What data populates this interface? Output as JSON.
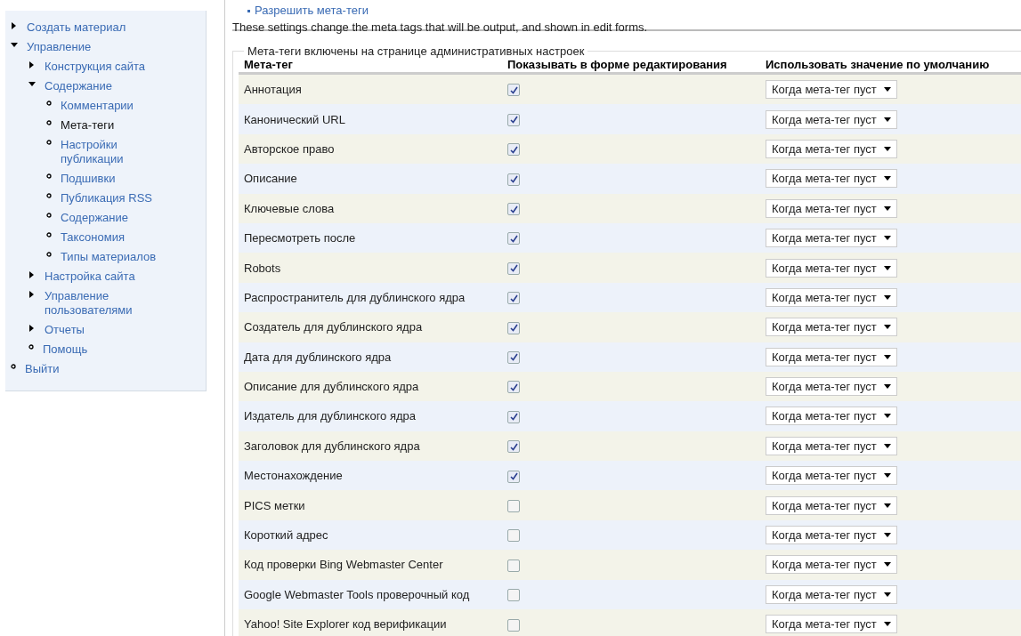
{
  "sidebar": {
    "items": [
      {
        "label": "Создать материал",
        "kind": "branch",
        "expanded": false,
        "selected": false
      },
      {
        "label": "Управление",
        "kind": "branch",
        "expanded": true,
        "selected": false,
        "children": [
          {
            "label": "Конструкция сайта",
            "kind": "branch",
            "expanded": false,
            "selected": false
          },
          {
            "label": "Содержание",
            "kind": "branch",
            "expanded": true,
            "selected": false,
            "children": [
              {
                "label": "Комментарии",
                "kind": "leaf",
                "selected": false
              },
              {
                "label": "Мета-теги",
                "kind": "leaf",
                "selected": true
              },
              {
                "label": "Настройки публикации",
                "kind": "leaf",
                "selected": false
              },
              {
                "label": "Подшивки",
                "kind": "leaf",
                "selected": false
              },
              {
                "label": "Публикация RSS",
                "kind": "leaf",
                "selected": false
              },
              {
                "label": "Содержание",
                "kind": "leaf",
                "selected": false
              },
              {
                "label": "Таксономия",
                "kind": "leaf",
                "selected": false
              },
              {
                "label": "Типы материалов",
                "kind": "leaf",
                "selected": false
              }
            ]
          },
          {
            "label": "Настройка сайта",
            "kind": "branch",
            "expanded": false,
            "selected": false
          },
          {
            "label": "Управление пользователями",
            "kind": "branch",
            "expanded": false,
            "selected": false
          },
          {
            "label": "Отчеты",
            "kind": "branch",
            "expanded": false,
            "selected": false
          },
          {
            "label": "Помощь",
            "kind": "leaf",
            "selected": false
          }
        ]
      },
      {
        "label": "Выйти",
        "kind": "leaf",
        "selected": false
      }
    ]
  },
  "top_link": "Разрешить мета-теги",
  "description": "These settings change the meta tags that will be output, and shown in edit forms.",
  "fieldset": {
    "legend": "Мета-теги включены на странице административных настроек",
    "columns": [
      "Мета-тег",
      "Показывать в форме редактирования",
      "Использовать значение по умолчанию"
    ],
    "rows": [
      {
        "name": "Аннотация",
        "checked": true,
        "default": "Когда мета-тег пуст"
      },
      {
        "name": "Канонический URL",
        "checked": true,
        "default": "Когда мета-тег пуст"
      },
      {
        "name": "Авторское право",
        "checked": true,
        "default": "Когда мета-тег пуст"
      },
      {
        "name": "Описание",
        "checked": true,
        "default": "Когда мета-тег пуст"
      },
      {
        "name": "Ключевые слова",
        "checked": true,
        "default": "Когда мета-тег пуст"
      },
      {
        "name": "Пересмотреть после",
        "checked": true,
        "default": "Когда мета-тег пуст"
      },
      {
        "name": "Robots",
        "checked": true,
        "default": "Когда мета-тег пуст"
      },
      {
        "name": "Распространитель для дублинского ядра",
        "checked": true,
        "default": "Когда мета-тег пуст"
      },
      {
        "name": "Создатель для дублинского ядра",
        "checked": true,
        "default": "Когда мета-тег пуст"
      },
      {
        "name": "Дата для дублинского ядра",
        "checked": true,
        "default": "Когда мета-тег пуст"
      },
      {
        "name": "Описание для дублинского ядра",
        "checked": true,
        "default": "Когда мета-тег пуст"
      },
      {
        "name": "Издатель для дублинского ядра",
        "checked": true,
        "default": "Когда мета-тег пуст"
      },
      {
        "name": "Заголовок для дублинского ядра",
        "checked": true,
        "default": "Когда мета-тег пуст"
      },
      {
        "name": "Местонахождение",
        "checked": true,
        "default": "Когда мета-тег пуст"
      },
      {
        "name": "PICS метки",
        "checked": false,
        "default": "Когда мета-тег пуст"
      },
      {
        "name": "Короткий адрес",
        "checked": false,
        "default": "Когда мета-тег пуст"
      },
      {
        "name": "Код проверки Bing Webmaster Center",
        "checked": false,
        "default": "Когда мета-тег пуст"
      },
      {
        "name": "Google Webmaster Tools проверочный код",
        "checked": false,
        "default": "Когда мета-тег пуст"
      },
      {
        "name": "Yahoo! Site Explorer код верификации",
        "checked": false,
        "default": "Когда мета-тег пуст"
      }
    ]
  }
}
